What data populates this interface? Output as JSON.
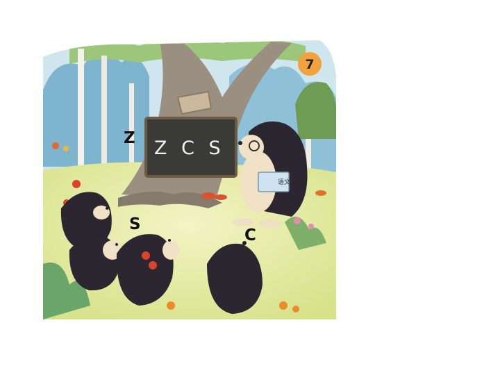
{
  "illustration": {
    "page_number": "7",
    "blackboard_text": "Z C S",
    "book_cover_text": "语文",
    "letter_labels": {
      "z": "Z",
      "s": "S",
      "c": "C"
    },
    "colors": {
      "page_badge": "#f0a23c",
      "blackboard": "#3a3a36",
      "grass": "#dfe89a",
      "sky": "#bfe0f0",
      "hedgehog_quills": "#2c2630"
    }
  }
}
